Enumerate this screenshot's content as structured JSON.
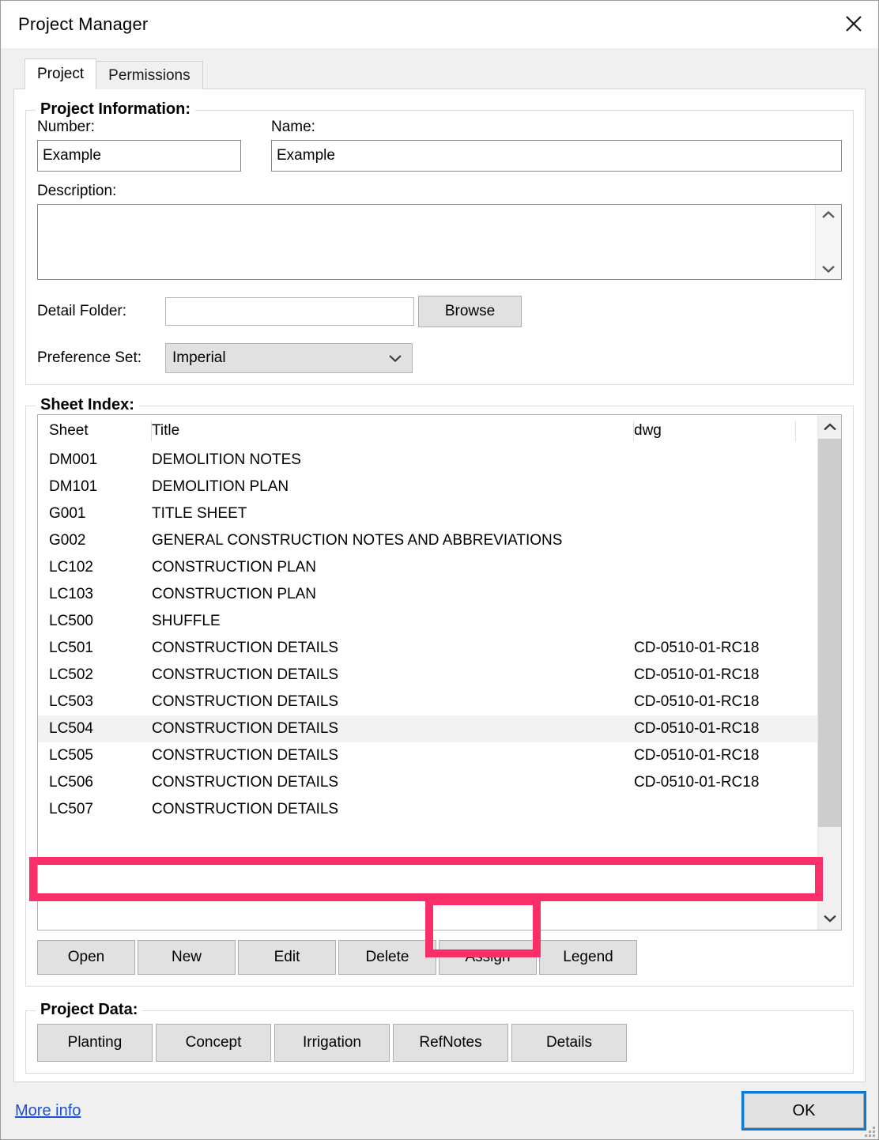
{
  "window": {
    "title": "Project Manager",
    "close_icon": "close-icon"
  },
  "tabs": [
    {
      "label": "Project",
      "active": true
    },
    {
      "label": "Permissions",
      "active": false
    }
  ],
  "project_information": {
    "group_label": "Project Information:",
    "number_label": "Number:",
    "number_value": "Example",
    "number_placeholder": "",
    "name_label": "Name:",
    "name_value": "Example",
    "name_placeholder": "",
    "description_label": "Description:",
    "description_value": "",
    "description_placeholder": "",
    "detail_folder_label": "Detail Folder:",
    "detail_folder_value": "",
    "detail_folder_placeholder": "",
    "browse_label": "Browse",
    "preference_set_label": "Preference Set:",
    "preference_set_value": "Imperial"
  },
  "sheet_index": {
    "group_label": "Sheet Index:",
    "columns": [
      "Sheet",
      "Title",
      "dwg"
    ],
    "rows": [
      {
        "sheet": "DM001",
        "title": "DEMOLITION NOTES",
        "dwg": "",
        "selected": false
      },
      {
        "sheet": "DM101",
        "title": "DEMOLITION PLAN",
        "dwg": "",
        "selected": false
      },
      {
        "sheet": "G001",
        "title": "TITLE SHEET",
        "dwg": "",
        "selected": false
      },
      {
        "sheet": "G002",
        "title": "GENERAL CONSTRUCTION NOTES AND ABBREVIATIONS",
        "dwg": "",
        "selected": false
      },
      {
        "sheet": "LC102",
        "title": "CONSTRUCTION PLAN",
        "dwg": "",
        "selected": false
      },
      {
        "sheet": "LC103",
        "title": "CONSTRUCTION PLAN",
        "dwg": "",
        "selected": false
      },
      {
        "sheet": "LC500",
        "title": "SHUFFLE",
        "dwg": "",
        "selected": false
      },
      {
        "sheet": "LC501",
        "title": "CONSTRUCTION DETAILS",
        "dwg": "CD-0510-01-RC18",
        "selected": false
      },
      {
        "sheet": "LC502",
        "title": "CONSTRUCTION DETAILS",
        "dwg": "CD-0510-01-RC18",
        "selected": false
      },
      {
        "sheet": "LC503",
        "title": "CONSTRUCTION DETAILS",
        "dwg": "CD-0510-01-RC18",
        "selected": false
      },
      {
        "sheet": "LC504",
        "title": "CONSTRUCTION DETAILS",
        "dwg": "CD-0510-01-RC18",
        "selected": true
      },
      {
        "sheet": "LC505",
        "title": "CONSTRUCTION DETAILS",
        "dwg": "CD-0510-01-RC18",
        "selected": false
      },
      {
        "sheet": "LC506",
        "title": "CONSTRUCTION DETAILS",
        "dwg": "CD-0510-01-RC18",
        "selected": false
      },
      {
        "sheet": "LC507",
        "title": "CONSTRUCTION DETAILS",
        "dwg": "",
        "selected": false
      }
    ],
    "buttons": [
      "Open",
      "New",
      "Edit",
      "Delete",
      "Assign",
      "Legend"
    ],
    "scrollbar": {
      "up_icon": "chevron-up-icon",
      "down_icon": "chevron-down-icon"
    }
  },
  "project_data": {
    "group_label": "Project Data:",
    "buttons": [
      "Planting",
      "Concept",
      "Irrigation",
      "RefNotes",
      "Details"
    ]
  },
  "footer": {
    "more_info_label": "More info",
    "ok_label": "OK"
  },
  "annotations": {
    "highlight_color": "#FA2E68",
    "boxes": [
      "sheet-row-lc507",
      "assign-button"
    ]
  }
}
